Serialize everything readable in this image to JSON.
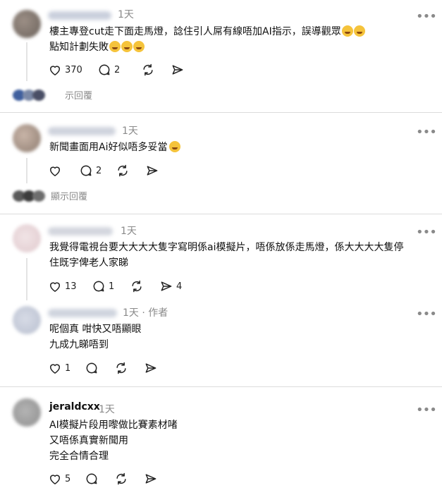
{
  "posts": [
    {
      "time": "1天",
      "author_tag": "",
      "lines": [
        "樓主專登cut走下面走馬燈，諗住引人屌有線唔加AI指示，誤導觀眾",
        "點知計劃失敗"
      ],
      "emoji_line1": 2,
      "emoji_line2": 3,
      "likes": "370",
      "replies": "2",
      "reposts": "",
      "shares": "",
      "show_replies": "示回覆"
    },
    {
      "time": "1天",
      "lines": [
        "新聞畫面用Ai好似唔多妥當"
      ],
      "likes": "",
      "replies": "2",
      "reposts": "",
      "shares": "",
      "show_replies": "顯示回覆"
    },
    {
      "time": "1天",
      "lines": [
        "我覺得電視台要大大大大隻字寫明係ai模擬片，唔係放係走馬燈，係大大大大隻停",
        "住既字俾老人家睇"
      ],
      "likes": "13",
      "replies": "1",
      "reposts": "",
      "shares": "4"
    },
    {
      "time": "1天",
      "author_tag": "· 作者",
      "lines": [
        "呢個真 咁快又唔顯眼",
        "九成九睇唔到"
      ],
      "likes": "1",
      "replies": "",
      "reposts": "",
      "shares": ""
    },
    {
      "username": "jeraldcxx",
      "time": "1天",
      "lines": [
        "AI模擬片段用嚟做比賽素材啫",
        "又唔係真實新聞用",
        "完全合情合理"
      ],
      "likes": "5",
      "replies": "",
      "reposts": "",
      "shares": ""
    }
  ],
  "icons": {
    "like": "heart-icon",
    "reply": "comment-icon",
    "repost": "repost-icon",
    "share": "share-icon",
    "more": "more-icon"
  },
  "more_glyph": "•••"
}
